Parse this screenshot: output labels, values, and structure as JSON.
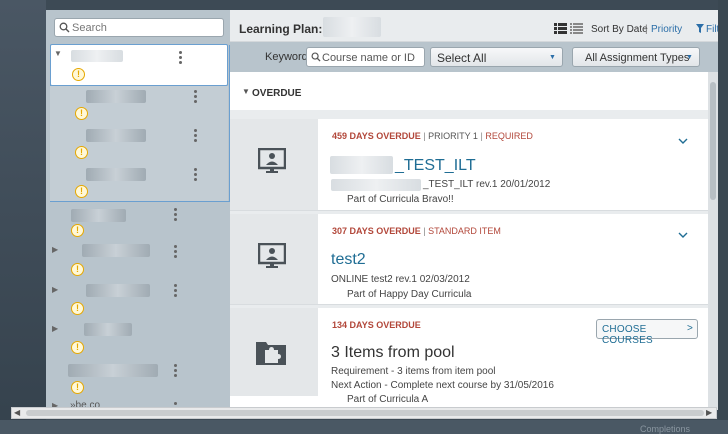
{
  "sidebar": {
    "search_placeholder": "Search",
    "warn_glyph": "!",
    "partial_label": "»be.co"
  },
  "header": {
    "title": "Learning Plan:",
    "sort_label": "Sort By Date",
    "sort_sep": "|",
    "priority_label": "Priority",
    "filter_label": "Filter"
  },
  "filters": {
    "keyword_label": "Keyword",
    "keyword_placeholder": "Course name or ID",
    "select_all": "Select All",
    "assignment_types": "All Assignment Types"
  },
  "section": {
    "title": "OVERDUE"
  },
  "cards": [
    {
      "overdue": "459 DAYS OVERDUE",
      "sep": "|",
      "priority": "PRIORITY 1",
      "required": "REQUIRED",
      "title": "_TEST_ILT",
      "subtitle": "_TEST_ILT rev.1 20/01/2012",
      "part_of": "Part of Curricula Bravo!!"
    },
    {
      "overdue": "307 DAYS OVERDUE",
      "sep": "|",
      "item_type": "STANDARD ITEM",
      "title": "test2",
      "subtitle": "ONLINE test2 rev.1 02/03/2012",
      "part_of": "Part of Happy Day Curricula"
    },
    {
      "overdue": "134 DAYS OVERDUE",
      "button": "CHOOSE COURSES",
      "button_arrow": ">",
      "title": "3 Items from pool",
      "line1": "Requirement - 3 items from item pool",
      "line2": "Next Action - Complete next course by 31/05/2016",
      "part_of": "Part of Curricula A"
    }
  ],
  "colors": {
    "overdue_red": "#b2473a",
    "link_blue": "#1f6d94",
    "warning_yellow": "#e6a800",
    "sidebar_bg": "#b8c4cc"
  },
  "icons": {
    "search": "search-icon",
    "warning": "warning-icon",
    "kebab": "kebab-menu-icon",
    "chevron": "chevron-down-icon",
    "course": "monitor-person-icon",
    "pool": "folder-puzzle-icon",
    "list_view": "list-view-icon",
    "filter": "filter-icon"
  },
  "footer": {
    "partial_text": "Completions"
  }
}
